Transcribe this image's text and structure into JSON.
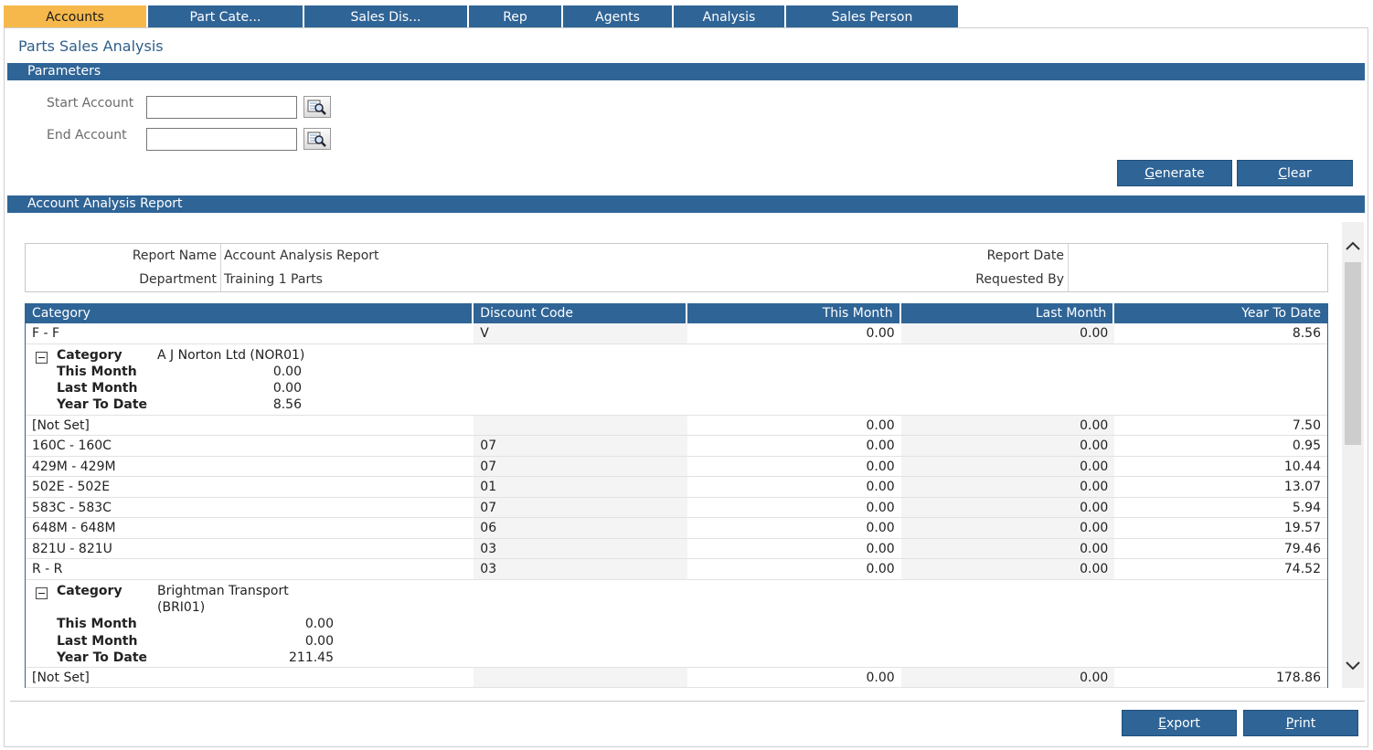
{
  "tabs": [
    {
      "label": "Accounts",
      "active": true
    },
    {
      "label": "Part Cate...",
      "active": false
    },
    {
      "label": "Sales Dis...",
      "active": false
    },
    {
      "label": "Rep",
      "active": false
    },
    {
      "label": "Agents",
      "active": false
    },
    {
      "label": "Analysis",
      "active": false
    },
    {
      "label": "Sales Person",
      "active": false
    }
  ],
  "page_title": "Parts Sales Analysis",
  "parameters": {
    "section_title": "Parameters",
    "start_account_label": "Start Account",
    "start_account_value": "",
    "end_account_label": "End Account",
    "end_account_value": "",
    "generate_label_accel": "G",
    "generate_label_rest": "enerate",
    "clear_label_accel": "C",
    "clear_label_rest": "lear"
  },
  "report": {
    "section_title": "Account Analysis Report",
    "report_name_label": "Report Name",
    "report_name_value": "Account Analysis Report",
    "department_label": "Department",
    "department_value": "Training 1 Parts",
    "report_date_label": "Report Date",
    "report_date_value": "",
    "requested_by_label": "Requested By",
    "requested_by_value": "",
    "columns": [
      "Category",
      "Discount Code",
      "This Month",
      "Last Month",
      "Year To Date"
    ],
    "first_row": {
      "category": "F - F",
      "discount": "V",
      "this_month": "0.00",
      "last_month": "0.00",
      "ytd": "8.56"
    },
    "group1": {
      "category_label": "Category",
      "category_value": "A J Norton Ltd (NOR01)",
      "this_month_label": "This Month",
      "this_month_value": "0.00",
      "last_month_label": "Last Month",
      "last_month_value": "0.00",
      "ytd_label": "Year To Date",
      "ytd_value": "8.56"
    },
    "rows": [
      {
        "category": "[Not Set]",
        "discount": "",
        "this_month": "0.00",
        "last_month": "0.00",
        "ytd": "7.50"
      },
      {
        "category": "160C - 160C",
        "discount": "07",
        "this_month": "0.00",
        "last_month": "0.00",
        "ytd": "0.95"
      },
      {
        "category": "429M - 429M",
        "discount": "07",
        "this_month": "0.00",
        "last_month": "0.00",
        "ytd": "10.44"
      },
      {
        "category": "502E - 502E",
        "discount": "01",
        "this_month": "0.00",
        "last_month": "0.00",
        "ytd": "13.07"
      },
      {
        "category": "583C - 583C",
        "discount": "07",
        "this_month": "0.00",
        "last_month": "0.00",
        "ytd": "5.94"
      },
      {
        "category": "648M - 648M",
        "discount": "06",
        "this_month": "0.00",
        "last_month": "0.00",
        "ytd": "19.57"
      },
      {
        "category": "821U - 821U",
        "discount": "03",
        "this_month": "0.00",
        "last_month": "0.00",
        "ytd": "79.46"
      },
      {
        "category": "R - R",
        "discount": "03",
        "this_month": "0.00",
        "last_month": "0.00",
        "ytd": "74.52"
      }
    ],
    "group2": {
      "category_label": "Category",
      "category_value_line1": "Brightman Transport",
      "category_value_line2": "(BRI01)",
      "this_month_label": "This Month",
      "this_month_value": "0.00",
      "last_month_label": "Last Month",
      "last_month_value": "0.00",
      "ytd_label": "Year To Date",
      "ytd_value": "211.45"
    },
    "last_row": {
      "category": "[Not Set]",
      "discount": "",
      "this_month": "0.00",
      "last_month": "0.00",
      "ytd": "178.86"
    }
  },
  "footer": {
    "export_label_accel": "E",
    "export_label_rest": "xport",
    "print_label_accel": "P",
    "print_label_rest": "rint"
  },
  "colors": {
    "accent": "#2f6496",
    "active_tab": "#f6b84b"
  }
}
